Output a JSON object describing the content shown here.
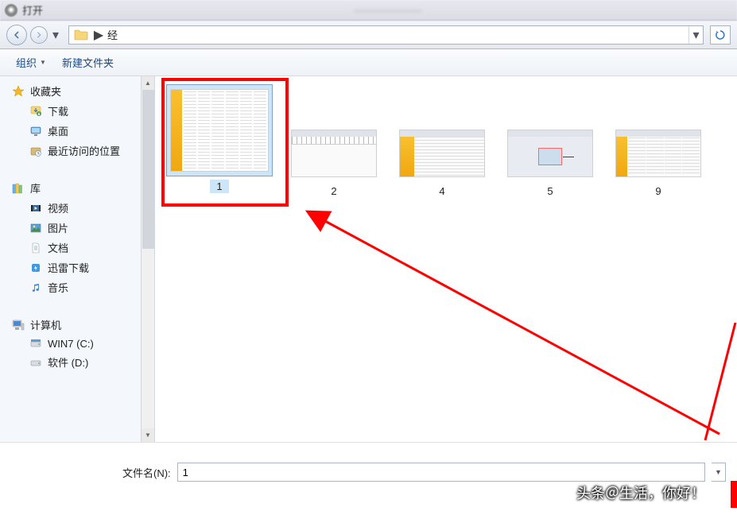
{
  "window": {
    "title": "打开",
    "center_blur": "———————"
  },
  "nav": {
    "folder_name": "经",
    "separator": "▶"
  },
  "toolbar": {
    "organize": "组织",
    "new_folder": "新建文件夹"
  },
  "sidebar": {
    "favorites": {
      "label": "收藏夹",
      "items": [
        {
          "icon": "download",
          "label": "下载"
        },
        {
          "icon": "desktop",
          "label": "桌面"
        },
        {
          "icon": "recent",
          "label": "最近访问的位置"
        }
      ]
    },
    "libraries": {
      "label": "库",
      "items": [
        {
          "icon": "video",
          "label": "视频"
        },
        {
          "icon": "pictures",
          "label": "图片"
        },
        {
          "icon": "documents",
          "label": "文档"
        },
        {
          "icon": "xunlei",
          "label": "迅雷下载"
        },
        {
          "icon": "music",
          "label": "音乐"
        }
      ]
    },
    "computer": {
      "label": "计算机",
      "items": [
        {
          "icon": "drive",
          "label": "WIN7 (C:)"
        },
        {
          "icon": "drive",
          "label": "软件 (D:)"
        }
      ]
    }
  },
  "files": [
    {
      "name": "1",
      "selected": true,
      "type": "spreadsheet"
    },
    {
      "name": "2",
      "selected": false,
      "type": "ruler-app"
    },
    {
      "name": "4",
      "selected": false,
      "type": "spreadsheet-app"
    },
    {
      "name": "5",
      "selected": false,
      "type": "image-app"
    },
    {
      "name": "9",
      "selected": false,
      "type": "spreadsheet-app"
    }
  ],
  "filename": {
    "label": "文件名(N):",
    "value": "1"
  },
  "watermark": "头条＠生活，你好！"
}
